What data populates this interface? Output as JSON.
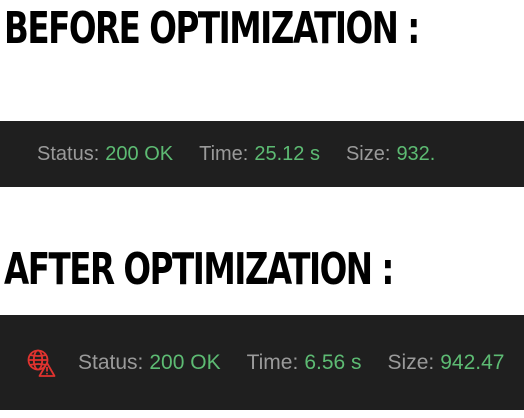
{
  "before": {
    "heading": "BEFORE OPTIMIZATION :",
    "status_label": "Status:",
    "status_value": "200 OK",
    "time_label": "Time:",
    "time_value": "25.12 s",
    "size_label": "Size:",
    "size_value": "932."
  },
  "after": {
    "heading": "AFTER OPTIMIZATION :",
    "icon": "globe-warning-icon",
    "status_label": "Status:",
    "status_value": "200 OK",
    "time_label": "Time:",
    "time_value": "6.56 s",
    "size_label": "Size:",
    "size_value": "942.47"
  },
  "colors": {
    "bar_background": "#1f1f1f",
    "label": "#9a9a9a",
    "value": "#5dbb73",
    "warning_icon": "#e0332f"
  }
}
